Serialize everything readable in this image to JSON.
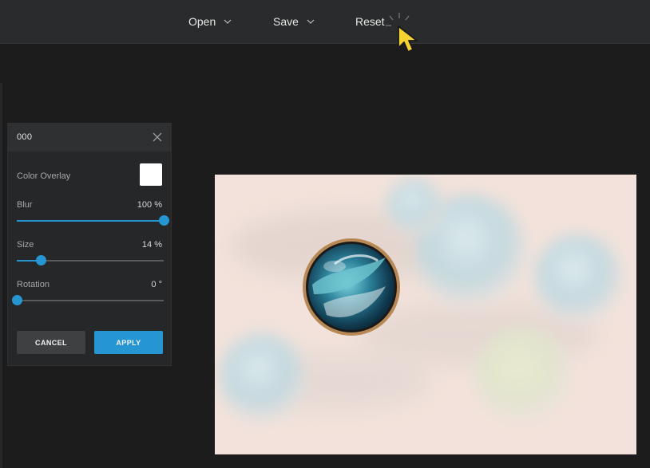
{
  "toolbar": {
    "open_label": "Open",
    "save_label": "Save",
    "reset_label": "Reset"
  },
  "panel": {
    "title": "000",
    "color_overlay_label": "Color Overlay",
    "overlay_color": "#ffffff",
    "blur": {
      "label": "Blur",
      "value": 100,
      "display": "100 %",
      "fraction": 1.0
    },
    "size": {
      "label": "Size",
      "value": 14,
      "display": "14 %",
      "fraction": 0.165
    },
    "rotation": {
      "label": "Rotation",
      "value": 0,
      "display": "0 °",
      "fraction": 0.0
    },
    "cancel_label": "CANCEL",
    "apply_label": "APPLY"
  },
  "colors": {
    "accent": "#2696d3",
    "topbar": "#2a2b2c",
    "background": "#1c1c1d",
    "panel": "#262728"
  },
  "icons": {
    "open_chevron": "chevron-down-icon",
    "save_chevron": "chevron-down-icon",
    "close": "close-icon",
    "cursor": "pointer-cursor-icon"
  }
}
